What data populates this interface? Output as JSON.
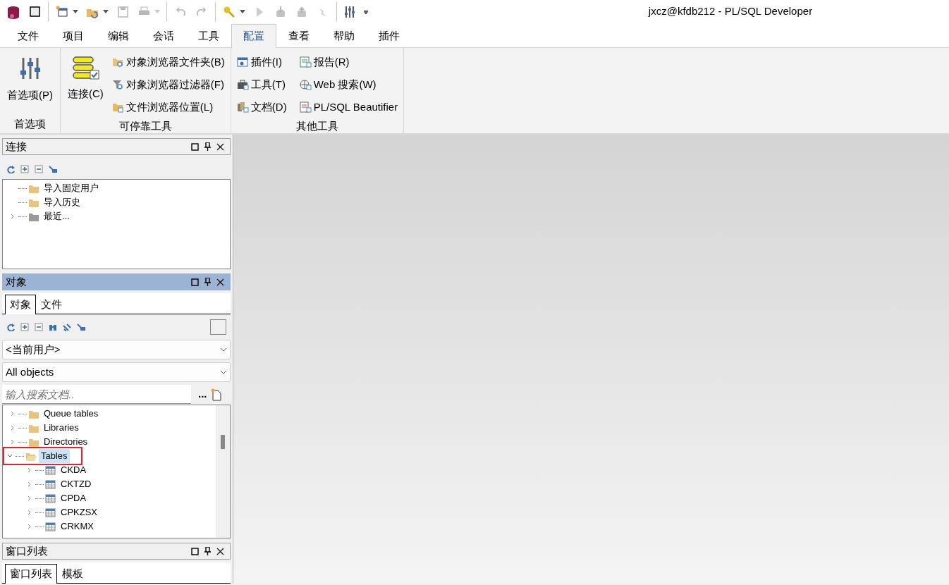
{
  "window": {
    "title": "jxcz@kfdb212 - PL/SQL Developer"
  },
  "quick_access": [
    {
      "kind": "button",
      "disabled": false,
      "has_menu": false
    },
    {
      "kind": "button",
      "disabled": false,
      "has_menu": false
    },
    {
      "kind": "separator"
    },
    {
      "kind": "button",
      "disabled": false,
      "has_menu": true
    },
    {
      "kind": "button",
      "disabled": false,
      "has_menu": true
    },
    {
      "kind": "button",
      "disabled": true,
      "has_menu": false
    },
    {
      "kind": "button",
      "disabled": true,
      "has_menu": true
    },
    {
      "kind": "separator"
    },
    {
      "kind": "button",
      "disabled": true,
      "has_menu": false
    },
    {
      "kind": "button",
      "disabled": true,
      "has_menu": false
    },
    {
      "kind": "separator"
    },
    {
      "kind": "button",
      "disabled": false,
      "has_menu": true
    },
    {
      "kind": "button",
      "disabled": true,
      "has_menu": false
    },
    {
      "kind": "button",
      "disabled": true,
      "has_menu": false
    },
    {
      "kind": "button",
      "disabled": true,
      "has_menu": false
    },
    {
      "kind": "button",
      "disabled": true,
      "has_menu": false
    },
    {
      "kind": "separator"
    },
    {
      "kind": "button",
      "disabled": false,
      "has_menu": false
    },
    {
      "kind": "overflow"
    }
  ],
  "ribbon_tabs": [
    {
      "label": "文件",
      "selected": false
    },
    {
      "label": "项目",
      "selected": false
    },
    {
      "label": "编辑",
      "selected": false
    },
    {
      "label": "会话",
      "selected": false
    },
    {
      "label": "工具",
      "selected": false
    },
    {
      "label": "配置",
      "selected": true
    },
    {
      "label": "查看",
      "selected": false
    },
    {
      "label": "帮助",
      "selected": false
    },
    {
      "label": "插件",
      "selected": false
    }
  ],
  "ribbon_groups": [
    {
      "label": "首选项",
      "items": [
        {
          "kind": "large",
          "label": "首选项(P)"
        }
      ]
    },
    {
      "label": "可停靠工具",
      "items": [
        {
          "kind": "large",
          "label": "连接(C)"
        },
        {
          "kind": "small",
          "label": "对象浏览器文件夹(B)"
        },
        {
          "kind": "small",
          "label": "对象浏览器过滤器(F)"
        },
        {
          "kind": "small",
          "label": "文件浏览器位置(L)"
        }
      ]
    },
    {
      "label": "其他工具",
      "items": [
        {
          "kind": "small",
          "label": "插件(I)"
        },
        {
          "kind": "small",
          "label": "工具(T)"
        },
        {
          "kind": "small",
          "label": "文档(D)"
        },
        {
          "kind": "small",
          "label": "报告(R)"
        },
        {
          "kind": "small",
          "label": "Web 搜索(W)"
        },
        {
          "kind": "small",
          "label": "PL/SQL Beautifier"
        }
      ]
    }
  ],
  "connection_pane": {
    "title": "连接",
    "active": false,
    "tree": [
      {
        "label": "导入固定用户",
        "kind": "folder"
      },
      {
        "label": "导入历史",
        "kind": "folder"
      },
      {
        "label": "最近...",
        "kind": "grey-folder",
        "expanded": false
      }
    ]
  },
  "object_pane": {
    "title": "对象",
    "active": true,
    "tabs": [
      {
        "label": "对象",
        "selected": true
      },
      {
        "label": "文件",
        "selected": false
      }
    ],
    "owner_select": {
      "value": "<当前用户>"
    },
    "type_select": {
      "value": "All objects"
    },
    "search": {
      "placeholder": "输入搜索文档.."
    },
    "more_button": "...",
    "tree": [
      {
        "label": "Queue tables",
        "kind": "folder",
        "expanded": false,
        "selected": false
      },
      {
        "label": "Libraries",
        "kind": "folder",
        "expanded": false,
        "selected": false
      },
      {
        "label": "Directories",
        "kind": "folder",
        "expanded": false,
        "selected": false
      },
      {
        "label": "Tables",
        "kind": "folder",
        "expanded": true,
        "selected": true,
        "marked": true,
        "children": [
          {
            "label": "CKDA",
            "kind": "table",
            "expanded": false,
            "selected": false
          },
          {
            "label": "CKTZD",
            "kind": "table",
            "expanded": false,
            "selected": false
          },
          {
            "label": "CPDA",
            "kind": "table",
            "expanded": false,
            "selected": false
          },
          {
            "label": "CPKZSX",
            "kind": "table",
            "expanded": false,
            "selected": false
          },
          {
            "label": "CRKMX",
            "kind": "table",
            "expanded": false,
            "selected": false
          }
        ]
      }
    ]
  },
  "window_list_pane": {
    "title": "窗口列表",
    "active": false,
    "tabs": [
      {
        "label": "窗口列表",
        "selected": true
      },
      {
        "label": "模板",
        "selected": false
      }
    ]
  }
}
